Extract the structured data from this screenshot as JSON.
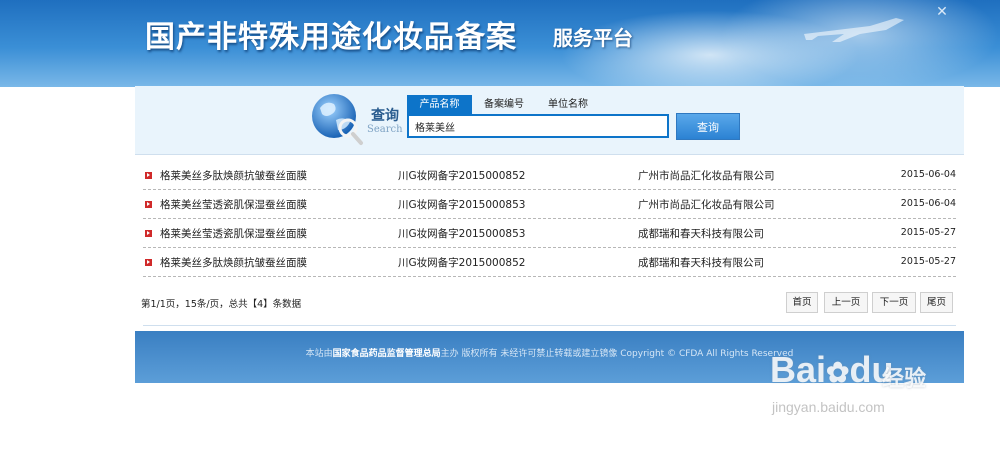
{
  "header": {
    "title": "国产非特殊用途化妆品备案",
    "subtitle": "服务平台",
    "close_icon": "close-icon"
  },
  "search": {
    "title_cn": "查询",
    "title_en": "Search",
    "tabs": [
      {
        "label": "产品名称",
        "active": true
      },
      {
        "label": "备案编号",
        "active": false
      },
      {
        "label": "单位名称",
        "active": false
      }
    ],
    "query": "格莱美丝",
    "button_label": "查询",
    "accent_color": "#0d74c9"
  },
  "results": [
    {
      "name": "格莱美丝多肽焕颜抗皱蚕丝面膜",
      "record_no": "川G妆网备字2015000852",
      "company": "广州市尚品汇化妆品有限公司",
      "date": "2015-06-04"
    },
    {
      "name": "格莱美丝莹透瓷肌保湿蚕丝面膜",
      "record_no": "川G妆网备字2015000853",
      "company": "广州市尚品汇化妆品有限公司",
      "date": "2015-06-04"
    },
    {
      "name": "格莱美丝莹透瓷肌保湿蚕丝面膜",
      "record_no": "川G妆网备字2015000853",
      "company": "成都瑞和春天科技有限公司",
      "date": "2015-05-27"
    },
    {
      "name": "格莱美丝多肽焕颜抗皱蚕丝面膜",
      "record_no": "川G妆网备字2015000852",
      "company": "成都瑞和春天科技有限公司",
      "date": "2015-05-27"
    }
  ],
  "pagination": {
    "summary": "第1/1页，15条/页，总共【4】条数据",
    "first": "首页",
    "prev": "上一页",
    "next": "下一页",
    "last": "尾页"
  },
  "footer": {
    "prefix": "本站由",
    "agency": "国家食品药品监督管理总局",
    "suffix": "主办 版权所有 未经许可禁止转载或建立镜像 Copyright © CFDA All Rights Reserved"
  },
  "watermark": {
    "logo": "Bai",
    "logo_tail": "du",
    "logo_cn": "经验",
    "url": "jingyan.baidu.com"
  }
}
